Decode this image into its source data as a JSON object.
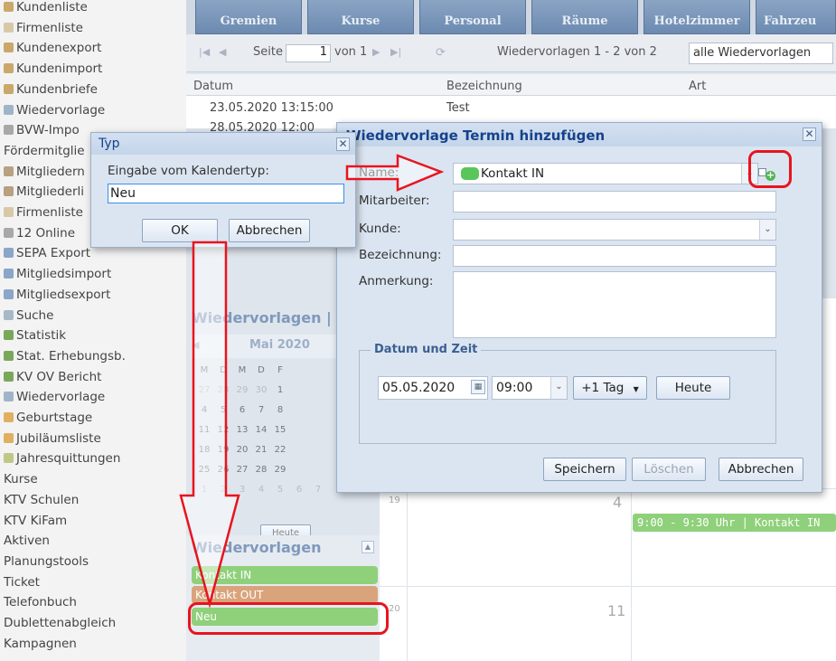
{
  "sidebar": {
    "items": [
      {
        "label": "Kundenliste",
        "icon": "user-icon"
      },
      {
        "label": "Firmenliste",
        "icon": "building-icon"
      },
      {
        "label": "Kundenexport",
        "icon": "user-icon"
      },
      {
        "label": "Kundenimport",
        "icon": "user-icon"
      },
      {
        "label": "Kundenbriefe",
        "icon": "user-icon"
      },
      {
        "label": "Wiedervorlage",
        "icon": "list-icon"
      },
      {
        "label": "BVW-Impo",
        "icon": "gear-icon"
      },
      {
        "label": "Fördermitglie",
        "icon": ""
      },
      {
        "label": "Mitgliedern",
        "icon": "people-icon"
      },
      {
        "label": "Mitgliederli",
        "icon": "people-icon"
      },
      {
        "label": "Firmenliste",
        "icon": "building-icon"
      },
      {
        "label": "12 Online",
        "icon": "gear-icon"
      },
      {
        "label": "SEPA Export",
        "icon": "export-icon"
      },
      {
        "label": "Mitgliedsimport",
        "icon": "export-icon"
      },
      {
        "label": "Mitgliedsexport",
        "icon": "export-icon"
      },
      {
        "label": "Suche",
        "icon": "search-icon"
      },
      {
        "label": "Statistik",
        "icon": "chart-icon"
      },
      {
        "label": "Stat. Erhebungsb.",
        "icon": "chart-icon"
      },
      {
        "label": "KV OV Bericht",
        "icon": "chart-icon"
      },
      {
        "label": "Wiedervorlage",
        "icon": "list-icon"
      },
      {
        "label": "Geburtstage",
        "icon": "cake-icon"
      },
      {
        "label": "Jubiläumsliste",
        "icon": "cake-icon"
      },
      {
        "label": "Jahresquittungen",
        "icon": "money-icon"
      },
      {
        "label": "Kurse",
        "icon": ""
      },
      {
        "label": "KTV Schulen",
        "icon": ""
      },
      {
        "label": "KTV KiFam",
        "icon": ""
      },
      {
        "label": "Aktiven",
        "icon": ""
      },
      {
        "label": "Planungstools",
        "icon": ""
      },
      {
        "label": "Ticket",
        "icon": ""
      },
      {
        "label": "Telefonbuch",
        "icon": ""
      },
      {
        "label": "Dublettenabgleich",
        "icon": ""
      },
      {
        "label": "Kampagnen",
        "icon": ""
      }
    ]
  },
  "tabs": [
    "Gremien",
    "Kurse",
    "Personal",
    "Räume",
    "Hotelzimmer",
    "Fahrzeu"
  ],
  "pager": {
    "page_label": "Seite",
    "page_value": "1",
    "of_label": "von 1",
    "records": "Wiedervorlagen 1 - 2 von 2",
    "filter_value": "alle Wiedervorlagen"
  },
  "grid": {
    "columns": [
      "Datum",
      "Bezeichnung",
      "Art"
    ],
    "rows": [
      {
        "datum": "23.05.2020 13:15:00",
        "bezeichnung": "Test"
      },
      {
        "datum": "28.05.2020 12:00",
        "bezeichnung": ""
      }
    ]
  },
  "calendar_panel": {
    "title": "Wiedervorlagen |",
    "month": "Mai 2020",
    "weekdays": [
      "M",
      "D",
      "M",
      "D",
      "F"
    ],
    "weeks": [
      [
        "27",
        "28",
        "29",
        "30",
        "1"
      ],
      [
        "4",
        "5",
        "6",
        "7",
        "8"
      ],
      [
        "11",
        "12",
        "13",
        "14",
        "15"
      ],
      [
        "18",
        "19",
        "20",
        "21",
        "22"
      ],
      [
        "25",
        "26",
        "27",
        "28",
        "29"
      ],
      [
        "1",
        "2",
        "3",
        "4",
        "5",
        "6",
        "7"
      ]
    ],
    "today_button": "Heute",
    "week_numbers": [
      "19",
      "20"
    ],
    "day_numbers": [
      "4",
      "11"
    ],
    "event": "9:00 - 9:30 Uhr | Kontakt IN"
  },
  "types_panel": {
    "title": "Wiedervorlagen",
    "items": [
      {
        "label": "Kontakt IN",
        "color": "#8fd07a"
      },
      {
        "label": "Kontakt OUT",
        "color": "#d9a47c"
      },
      {
        "label": "Neu",
        "color": "#8fd07a"
      }
    ]
  },
  "typ_dialog": {
    "title": "Typ",
    "prompt": "Eingabe vom Kalendertyp:",
    "input_value": "Neu",
    "ok": "OK",
    "cancel": "Abbrechen"
  },
  "termin_dialog": {
    "title": "Wiedervorlage Termin hinzufügen",
    "labels": {
      "name": "Name:",
      "mitarbeiter": "Mitarbeiter:",
      "kunde": "Kunde:",
      "bezeichnung": "Bezeichnung:",
      "anmerkung": "Anmerkung:"
    },
    "name_value": "Kontakt IN",
    "name_color": "#59c659",
    "fieldset": "Datum und Zeit",
    "date": "05.05.2020",
    "time": "09:00",
    "offset": "+1 Tag",
    "today": "Heute",
    "save": "Speichern",
    "delete": "Löschen",
    "cancel": "Abbrechen"
  },
  "colors": {
    "annotation_red": "#e8141e",
    "dialog_title": "#15428b"
  }
}
